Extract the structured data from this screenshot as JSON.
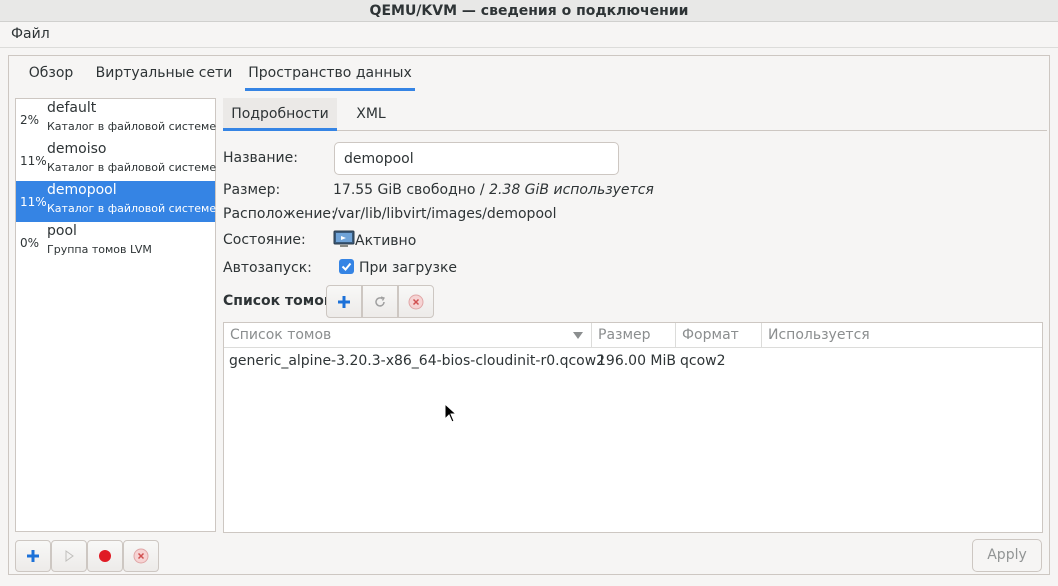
{
  "window": {
    "title": "QEMU/KVM — сведения о подключении"
  },
  "menu": {
    "file": "Файл"
  },
  "top_tabs": [
    {
      "label": "Обзор"
    },
    {
      "label": "Виртуальные сети"
    },
    {
      "label": "Пространство данных",
      "active": true
    }
  ],
  "pools": [
    {
      "percent": "2%",
      "name": "default",
      "type": "Каталог в файловой системе"
    },
    {
      "percent": "11%",
      "name": "demoiso",
      "type": "Каталог в файловой системе"
    },
    {
      "percent": "11%",
      "name": "demopool",
      "type": "Каталог в файловой системе",
      "selected": true
    },
    {
      "percent": "0%",
      "name": "pool",
      "type": "Группа томов LVM"
    }
  ],
  "detail_tabs": [
    {
      "label": "Подробности",
      "active": true
    },
    {
      "label": "XML"
    }
  ],
  "details": {
    "name_label": "Название:",
    "name_value": "demopool",
    "size_label": "Размер:",
    "size_free": "17.55 GiB свободно",
    "size_sep": " / ",
    "size_used": "2.38 GiB используется",
    "location_label": "Расположение:",
    "location_value": "/var/lib/libvirt/images/demopool",
    "state_label": "Состояние:",
    "state_value": "Активно",
    "autostart_label": "Автозапуск:",
    "autostart_value": "При загрузке",
    "autostart_checked": true
  },
  "volumes": {
    "title": "Список томов",
    "columns": [
      "Список томов",
      "Размер",
      "Формат",
      "Используется"
    ],
    "rows": [
      {
        "name": "generic_alpine-3.20.3-x86_64-bios-cloudinit-r0.qcow2",
        "size": "196.00 MiB",
        "format": "qcow2",
        "used_by": ""
      }
    ]
  },
  "buttons": {
    "apply": "Apply"
  },
  "colors": {
    "accent": "#3584e4",
    "stop_red": "#e01b24",
    "add_blue": "#1c71d8"
  }
}
